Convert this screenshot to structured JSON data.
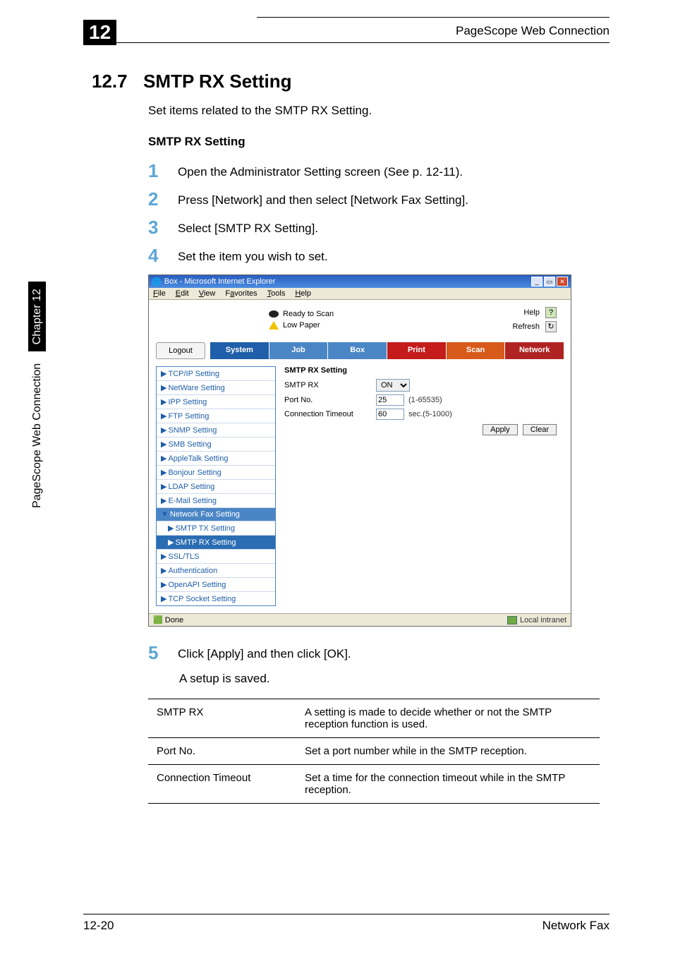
{
  "page": {
    "chapter_badge": "12",
    "header_right": "PageScope Web Connection",
    "section_number": "12.7",
    "section_title": "SMTP RX Setting",
    "intro": "Set items related to the SMTP RX Setting.",
    "sub_heading": "SMTP RX Setting"
  },
  "steps": [
    "Open the Administrator Setting screen (See p. 12-11).",
    "Press [Network] and then select [Network Fax Setting].",
    "Select [SMTP RX Setting].",
    "Set the item you wish to set."
  ],
  "step5": {
    "num": "5",
    "text": "Click [Apply] and then click [OK].",
    "result": "A setup is saved."
  },
  "screenshot": {
    "window_title": "Box - Microsoft Internet Explorer",
    "menu": {
      "file": "File",
      "edit": "Edit",
      "view": "View",
      "favorites": "Favorites",
      "tools": "Tools",
      "help": "Help"
    },
    "status": {
      "ready": "Ready to Scan",
      "low": "Low Paper"
    },
    "help_links": {
      "help": "Help",
      "refresh": "Refresh"
    },
    "tabs": {
      "logout": "Logout",
      "system": "System",
      "job": "Job",
      "box": "Box",
      "print": "Print",
      "scan": "Scan",
      "network": "Network"
    },
    "side": {
      "tcpip": "TCP/IP Setting",
      "netware": "NetWare Setting",
      "ipp": "IPP Setting",
      "ftp": "FTP Setting",
      "snmp": "SNMP Setting",
      "smb": "SMB Setting",
      "appletalk": "AppleTalk Setting",
      "bonjour": "Bonjour Setting",
      "ldap": "LDAP Setting",
      "email": "E-Mail Setting",
      "netfax": "Network Fax Setting",
      "smtptx": "SMTP TX Setting",
      "smtprx": "SMTP RX Setting",
      "ssltls": "SSL/TLS",
      "auth": "Authentication",
      "openapi": "OpenAPI Setting",
      "tcpsock": "TCP Socket Setting"
    },
    "form": {
      "heading": "SMTP RX Setting",
      "smtprx_label": "SMTP RX",
      "smtprx_value": "ON",
      "port_label": "Port No.",
      "port_value": "25",
      "port_hint": "(1-65535)",
      "timeout_label": "Connection Timeout",
      "timeout_value": "60",
      "timeout_hint": "sec.(5-1000)",
      "apply": "Apply",
      "clear": "Clear"
    },
    "statusbar": {
      "done": "Done",
      "intranet": "Local intranet"
    }
  },
  "table": {
    "rows": [
      {
        "k": "SMTP RX",
        "v": "A setting is made to decide whether or not the SMTP reception function is used."
      },
      {
        "k": "Port No.",
        "v": "Set a port number while in the SMTP reception."
      },
      {
        "k": "Connection Timeout",
        "v": "Set a time for the connection timeout while in the SMTP reception."
      }
    ]
  },
  "side_tab": {
    "text": "PageScope Web Connection",
    "chapter": "Chapter 12"
  },
  "footer": {
    "left": "12-20",
    "right": "Network Fax"
  }
}
